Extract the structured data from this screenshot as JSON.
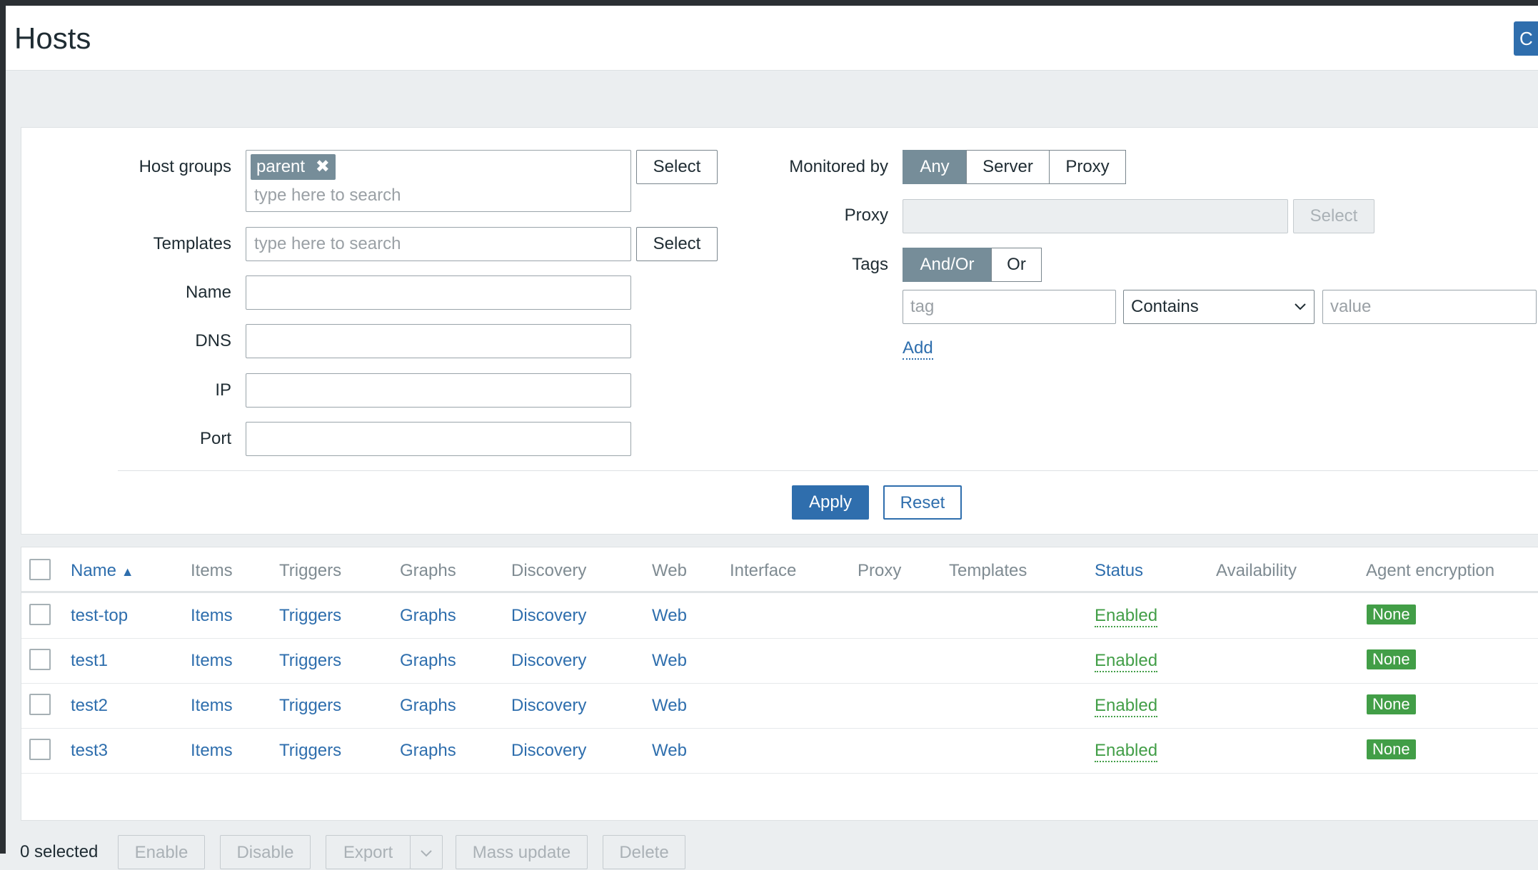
{
  "header": {
    "title": "Hosts",
    "create_label": "C"
  },
  "filter": {
    "host_groups": {
      "label": "Host groups",
      "chip": "parent",
      "placeholder": "type here to search",
      "select_label": "Select"
    },
    "templates": {
      "label": "Templates",
      "placeholder": "type here to search",
      "select_label": "Select"
    },
    "name": {
      "label": "Name",
      "value": ""
    },
    "dns": {
      "label": "DNS",
      "value": ""
    },
    "ip": {
      "label": "IP",
      "value": ""
    },
    "port": {
      "label": "Port",
      "value": ""
    },
    "monitored_by": {
      "label": "Monitored by",
      "options": [
        "Any",
        "Server",
        "Proxy"
      ],
      "selected": "Any"
    },
    "proxy": {
      "label": "Proxy",
      "value": "",
      "select_label": "Select"
    },
    "tags": {
      "label": "Tags",
      "options": [
        "And/Or",
        "Or"
      ],
      "selected": "And/Or",
      "tag_placeholder": "tag",
      "operator": "Contains",
      "value_placeholder": "value",
      "add_label": "Add"
    },
    "apply_label": "Apply",
    "reset_label": "Reset"
  },
  "table": {
    "columns": [
      "Name",
      "Items",
      "Triggers",
      "Graphs",
      "Discovery",
      "Web",
      "Interface",
      "Proxy",
      "Templates",
      "Status",
      "Availability",
      "Agent encryption"
    ],
    "sort_indicator": "▲",
    "rows": [
      {
        "name": "test-top",
        "items": "Items",
        "triggers": "Triggers",
        "graphs": "Graphs",
        "discovery": "Discovery",
        "web": "Web",
        "status": "Enabled",
        "encryption": "None"
      },
      {
        "name": "test1",
        "items": "Items",
        "triggers": "Triggers",
        "graphs": "Graphs",
        "discovery": "Discovery",
        "web": "Web",
        "status": "Enabled",
        "encryption": "None"
      },
      {
        "name": "test2",
        "items": "Items",
        "triggers": "Triggers",
        "graphs": "Graphs",
        "discovery": "Discovery",
        "web": "Web",
        "status": "Enabled",
        "encryption": "None"
      },
      {
        "name": "test3",
        "items": "Items",
        "triggers": "Triggers",
        "graphs": "Graphs",
        "discovery": "Discovery",
        "web": "Web",
        "status": "Enabled",
        "encryption": "None"
      }
    ]
  },
  "footer": {
    "selected_text": "0 selected",
    "buttons": [
      "Enable",
      "Disable",
      "Export",
      "Mass update",
      "Delete"
    ]
  },
  "colors": {
    "accent": "#2f6ead",
    "enabled": "#429e47",
    "segment_active": "#768d99"
  }
}
